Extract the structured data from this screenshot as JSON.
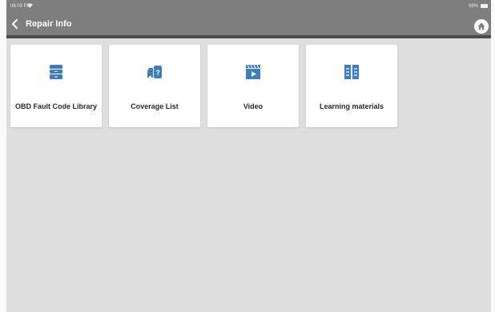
{
  "status_bar": {
    "time": "06:03 PM",
    "battery": "99%"
  },
  "header": {
    "title": "Repair Info"
  },
  "icons": {
    "back": "chevron-left-icon",
    "home": "home-icon",
    "wifi": "wifi-icon",
    "battery": "battery-icon"
  },
  "colors": {
    "header_bg": "#7e7e7e",
    "accent": "#3e7bbf",
    "page_bg": "#dedede"
  },
  "tiles": [
    {
      "label": "OBD Fault Code Library",
      "icon": "file-cabinet-icon"
    },
    {
      "label": "Coverage List",
      "icon": "car-question-icon"
    },
    {
      "label": "Video",
      "icon": "video-clapper-icon"
    },
    {
      "label": "Learning materials",
      "icon": "open-book-icon"
    }
  ]
}
